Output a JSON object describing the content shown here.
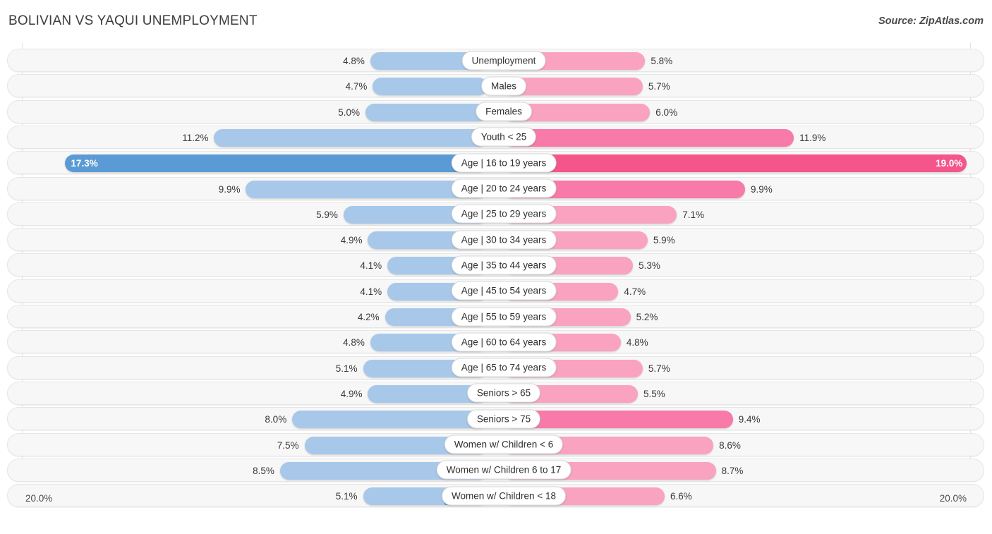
{
  "header": {
    "title": "BOLIVIAN VS YAQUI UNEMPLOYMENT",
    "source": "Source: ZipAtlas.com"
  },
  "axis": {
    "left_max_label": "20.0%",
    "right_max_label": "20.0%"
  },
  "legend": {
    "items": [
      {
        "label": "Bolivian",
        "color": "#6699dd"
      },
      {
        "label": "Yaqui",
        "color": "#f4568c"
      }
    ]
  },
  "colors": {
    "left_normal": "#a8c8ea",
    "left_highlight": "#5b9bd5",
    "right_normal": "#f9a3c0",
    "right_mid": "#f77aa9",
    "right_highlight": "#f4568c",
    "track": "#f7f7f7",
    "gridline": "#e3e3e3"
  },
  "chart_data": {
    "type": "bar",
    "title": "BOLIVIAN VS YAQUI UNEMPLOYMENT",
    "orientation": "horizontal-diverging",
    "xlabel": "",
    "ylabel": "",
    "xlim": [
      20.0,
      20.0
    ],
    "grid": true,
    "legend_position": "bottom-center",
    "categories": [
      "Unemployment",
      "Males",
      "Females",
      "Youth < 25",
      "Age | 16 to 19 years",
      "Age | 20 to 24 years",
      "Age | 25 to 29 years",
      "Age | 30 to 34 years",
      "Age | 35 to 44 years",
      "Age | 45 to 54 years",
      "Age | 55 to 59 years",
      "Age | 60 to 64 years",
      "Age | 65 to 74 years",
      "Seniors > 65",
      "Seniors > 75",
      "Women w/ Children < 6",
      "Women w/ Children 6 to 17",
      "Women w/ Children < 18"
    ],
    "series": [
      {
        "name": "Bolivian",
        "side": "left",
        "values": [
          4.8,
          4.7,
          5.0,
          11.2,
          17.3,
          9.9,
          5.9,
          4.9,
          4.1,
          4.1,
          4.2,
          4.8,
          5.1,
          4.9,
          8.0,
          7.5,
          8.5,
          5.1
        ],
        "labels": [
          "4.8%",
          "4.7%",
          "5.0%",
          "11.2%",
          "17.3%",
          "9.9%",
          "5.9%",
          "4.9%",
          "4.1%",
          "4.1%",
          "4.2%",
          "4.8%",
          "5.1%",
          "4.9%",
          "8.0%",
          "7.5%",
          "8.5%",
          "5.1%"
        ]
      },
      {
        "name": "Yaqui",
        "side": "right",
        "values": [
          5.8,
          5.7,
          6.0,
          11.9,
          19.0,
          9.9,
          7.1,
          5.9,
          5.3,
          4.7,
          5.2,
          4.8,
          5.7,
          5.5,
          9.4,
          8.6,
          8.7,
          6.6
        ],
        "labels": [
          "5.8%",
          "5.7%",
          "6.0%",
          "11.9%",
          "19.0%",
          "9.9%",
          "7.1%",
          "5.9%",
          "5.3%",
          "4.7%",
          "5.2%",
          "4.8%",
          "5.7%",
          "5.5%",
          "9.4%",
          "8.6%",
          "8.7%",
          "6.6%"
        ]
      }
    ],
    "highlight_row_index": 4
  }
}
